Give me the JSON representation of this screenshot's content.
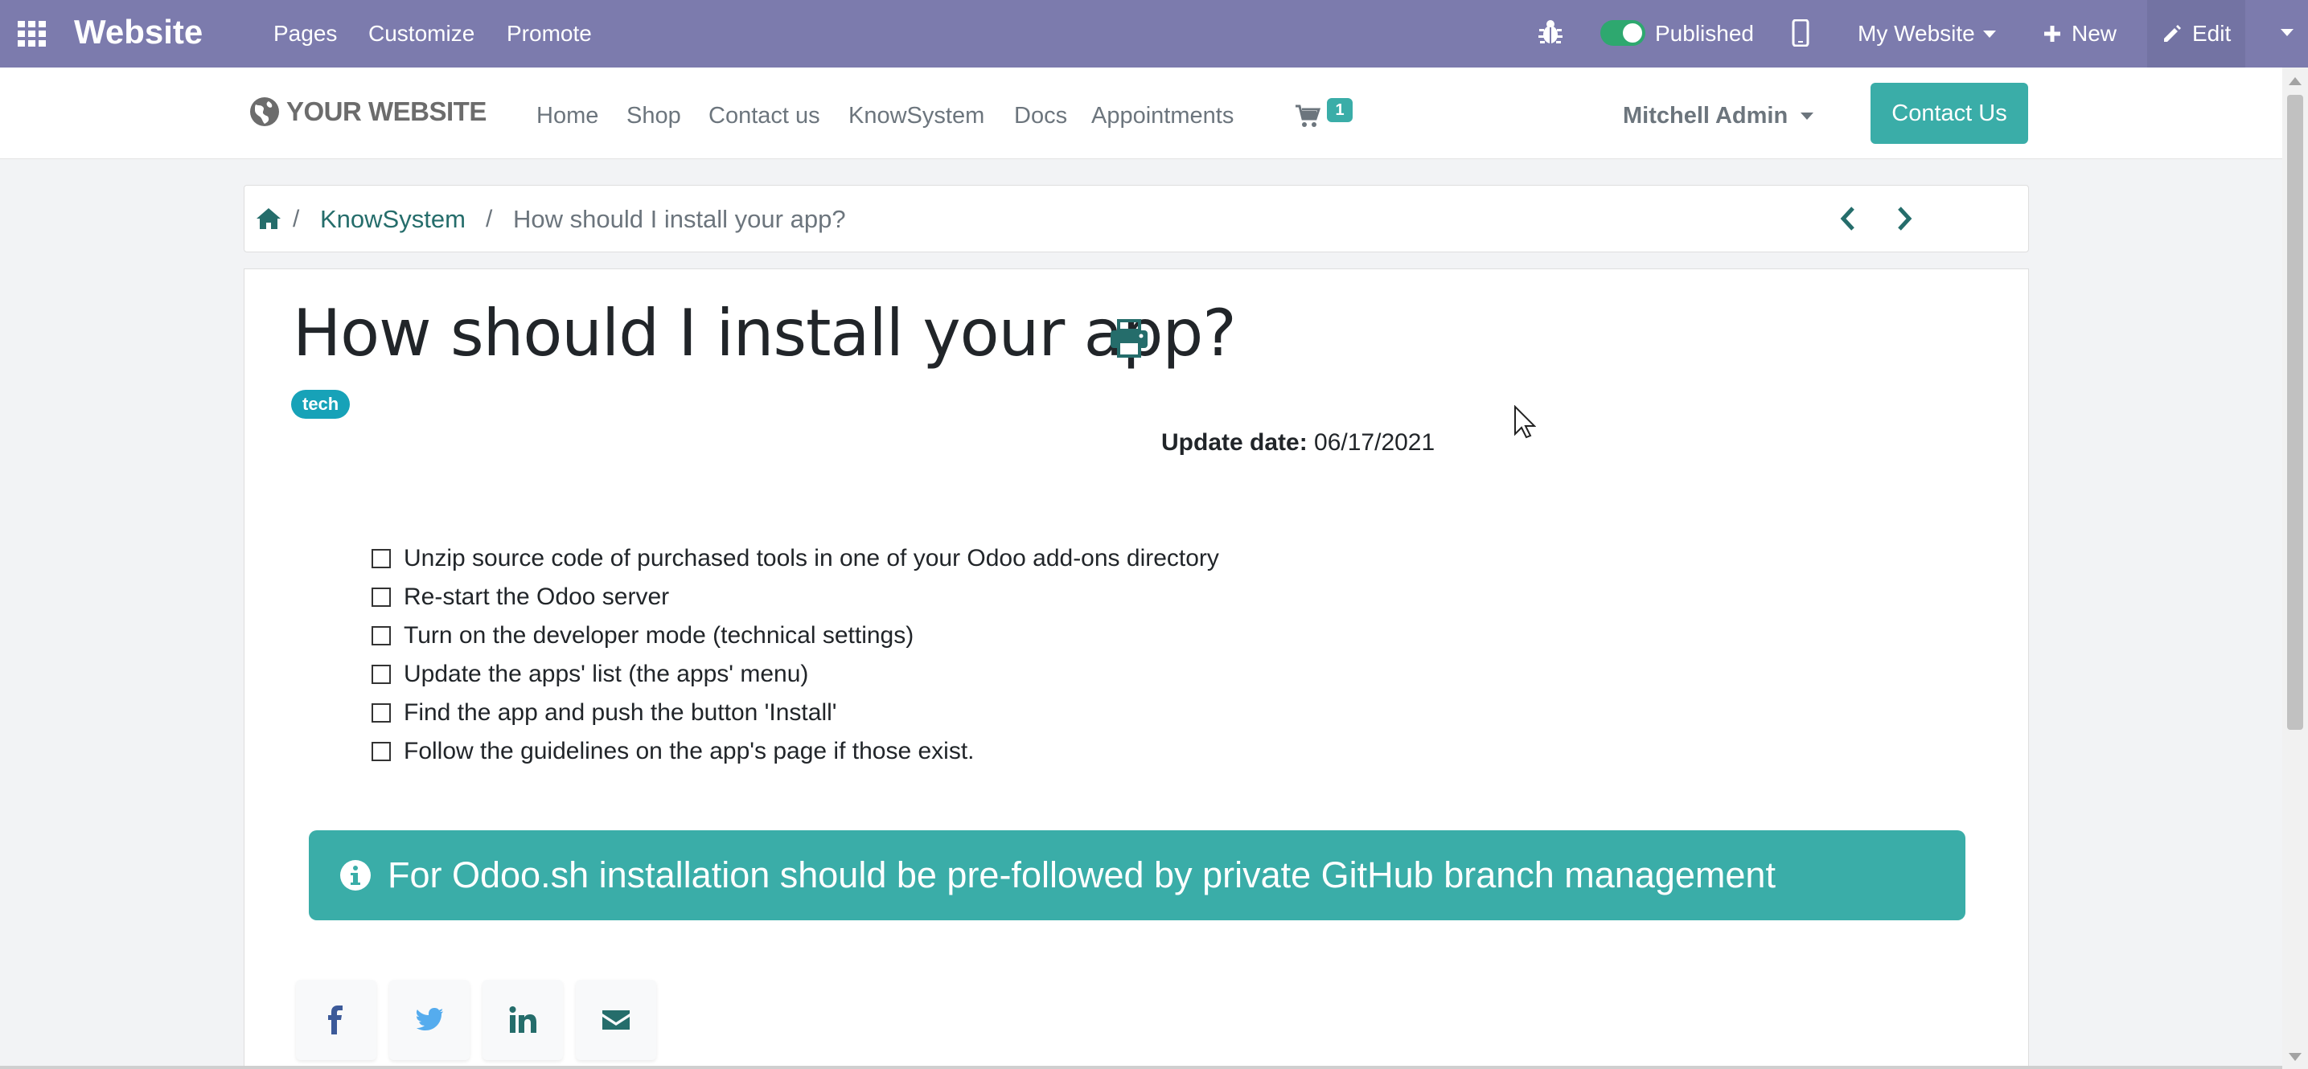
{
  "admin_bar": {
    "brand": "Website",
    "nav": [
      "Pages",
      "Customize",
      "Promote"
    ],
    "published_label": "Published",
    "published": true,
    "website_selector": "My Website",
    "new_label": "New",
    "edit_label": "Edit",
    "bg_color": "#7c7bad"
  },
  "site_header": {
    "logo_text": "YOUR WEBSITE",
    "nav": [
      "Home",
      "Shop",
      "Contact us",
      "KnowSystem",
      "Docs",
      "Appointments"
    ],
    "cart_count": "1",
    "user": "Mitchell Admin",
    "contact_button": "Contact Us",
    "accent_color": "#3aada8"
  },
  "breadcrumb": {
    "separator": "/",
    "parent": "KnowSystem",
    "current": "How should I install your app?"
  },
  "article": {
    "title": "How should I install your app?",
    "tag": "tech",
    "update_label": "Update date:",
    "update_value": "06/17/2021",
    "checklist": [
      "Unzip source code of purchased tools in one of your Odoo add-ons directory",
      "Re-start the Odoo server",
      "Turn on the developer mode (technical settings)",
      "Update the apps' list (the apps' menu)",
      "Find the app and push the button 'Install'",
      "Follow the guidelines on the app's page if those exist."
    ],
    "alert_text": "For Odoo.sh installation should be pre-followed by private GitHub branch management",
    "share_icons": [
      "facebook-icon",
      "twitter-icon",
      "linkedin-icon",
      "email-icon"
    ]
  }
}
